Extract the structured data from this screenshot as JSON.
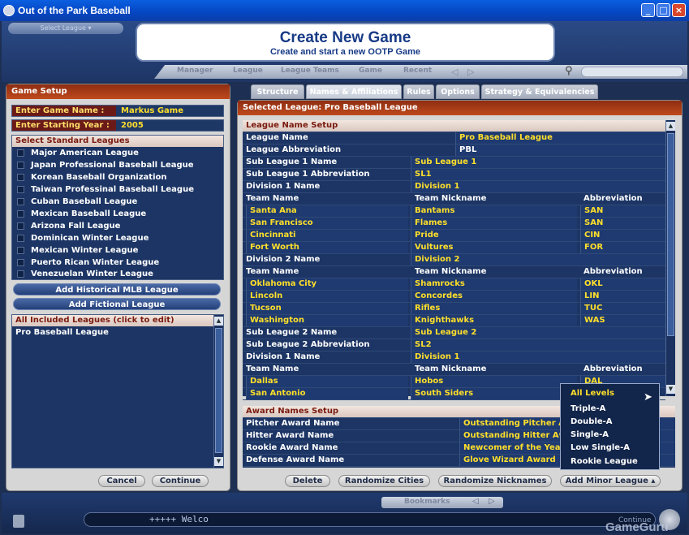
{
  "window": {
    "title": "Out of the Park Baseball"
  },
  "top": {
    "select_league": "Select League",
    "banner_title": "Create New Game",
    "banner_subtitle": "Create and start a new OOTP Game",
    "nav": [
      "Manager",
      "League",
      "League Teams",
      "Game",
      "Recent"
    ]
  },
  "left": {
    "title": "Game Setup",
    "game_name_label": "Enter Game Name :",
    "game_name_value": "Markus Game",
    "start_year_label": "Enter Starting Year :",
    "start_year_value": "2005",
    "std_header": "Select Standard Leagues",
    "std_leagues": [
      "Major American League",
      "Japan Professional Baseball League",
      "Korean Baseball Organization",
      "Taiwan Professinal Baseball League",
      "Cuban Baseball League",
      "Mexican Baseball League",
      "Arizona Fall League",
      "Dominican Winter League",
      "Mexican Winter League",
      "Puerto Rican Winter League",
      "Venezuelan Winter League"
    ],
    "add_historical": "Add Historical MLB League",
    "add_fictional": "Add Fictional League",
    "included_header": "All Included Leagues (click to edit)",
    "included": [
      "Pro Baseball League"
    ],
    "cancel": "Cancel",
    "continue": "Continue"
  },
  "tabs": [
    "Structure",
    "Names & Affiliations",
    "Rules",
    "Options",
    "Strategy & Equivalencies"
  ],
  "right": {
    "title": "Selected League: Pro Baseball League",
    "section1": "League Name Setup",
    "league_name_label": "League Name",
    "league_name_value": "Pro Baseball League",
    "league_abbr_label": "League Abbreviation",
    "league_abbr_value": "PBL",
    "sub1_name_label": "Sub League 1 Name",
    "sub1_name_value": "Sub League 1",
    "sub1_abbr_label": "Sub League 1 Abbreviation",
    "sub1_abbr_value": "SL1",
    "div1_label": "Division 1 Name",
    "div1_value": "Division 1",
    "col_team": "Team Name",
    "col_nick": "Team Nickname",
    "col_abbr": "Abbreviation",
    "teams_a": [
      [
        "Santa Ana",
        "Bantams",
        "SAN"
      ],
      [
        "San Francisco",
        "Flames",
        "SAN"
      ],
      [
        "Cincinnati",
        "Pride",
        "CIN"
      ],
      [
        "Fort Worth",
        "Vultures",
        "FOR"
      ]
    ],
    "div2_label": "Division 2 Name",
    "div2_value": "Division 2",
    "teams_b": [
      [
        "Oklahoma City",
        "Shamrocks",
        "OKL"
      ],
      [
        "Lincoln",
        "Concordes",
        "LIN"
      ],
      [
        "Tucson",
        "Rifles",
        "TUC"
      ],
      [
        "Washington",
        "Knighthawks",
        "WAS"
      ]
    ],
    "sub2_name_label": "Sub League 2 Name",
    "sub2_name_value": "Sub League 2",
    "sub2_abbr_label": "Sub League 2 Abbreviation",
    "sub2_abbr_value": "SL2",
    "div1b_label": "Division 1 Name",
    "div1b_value": "Division 1",
    "teams_c": [
      [
        "Dallas",
        "Hobos",
        "DAL"
      ],
      [
        "San Antonio",
        "South Siders",
        ""
      ]
    ],
    "section2": "Award Names Setup",
    "awards": [
      [
        "Pitcher Award Name",
        "Outstanding Pitcher Aw"
      ],
      [
        "Hitter Award Name",
        "Outstanding Hitter Aw"
      ],
      [
        "Rookie Award Name",
        "Newcomer of the Year"
      ],
      [
        "Defense Award Name",
        "Glove Wizard Award"
      ]
    ],
    "delete": "Delete",
    "rand_cities": "Randomize Cities",
    "rand_nicks": "Randomize Nicknames",
    "add_minor": "Add Minor League"
  },
  "dropdown": [
    "All Levels",
    "Triple-A",
    "Double-A",
    "Single-A",
    "Low Single-A",
    "Rookie League"
  ],
  "bottom": {
    "bookmarks": "Bookmarks",
    "console": "+++++ Welco",
    "continue": "Continue",
    "watermark": "GameGuru"
  }
}
